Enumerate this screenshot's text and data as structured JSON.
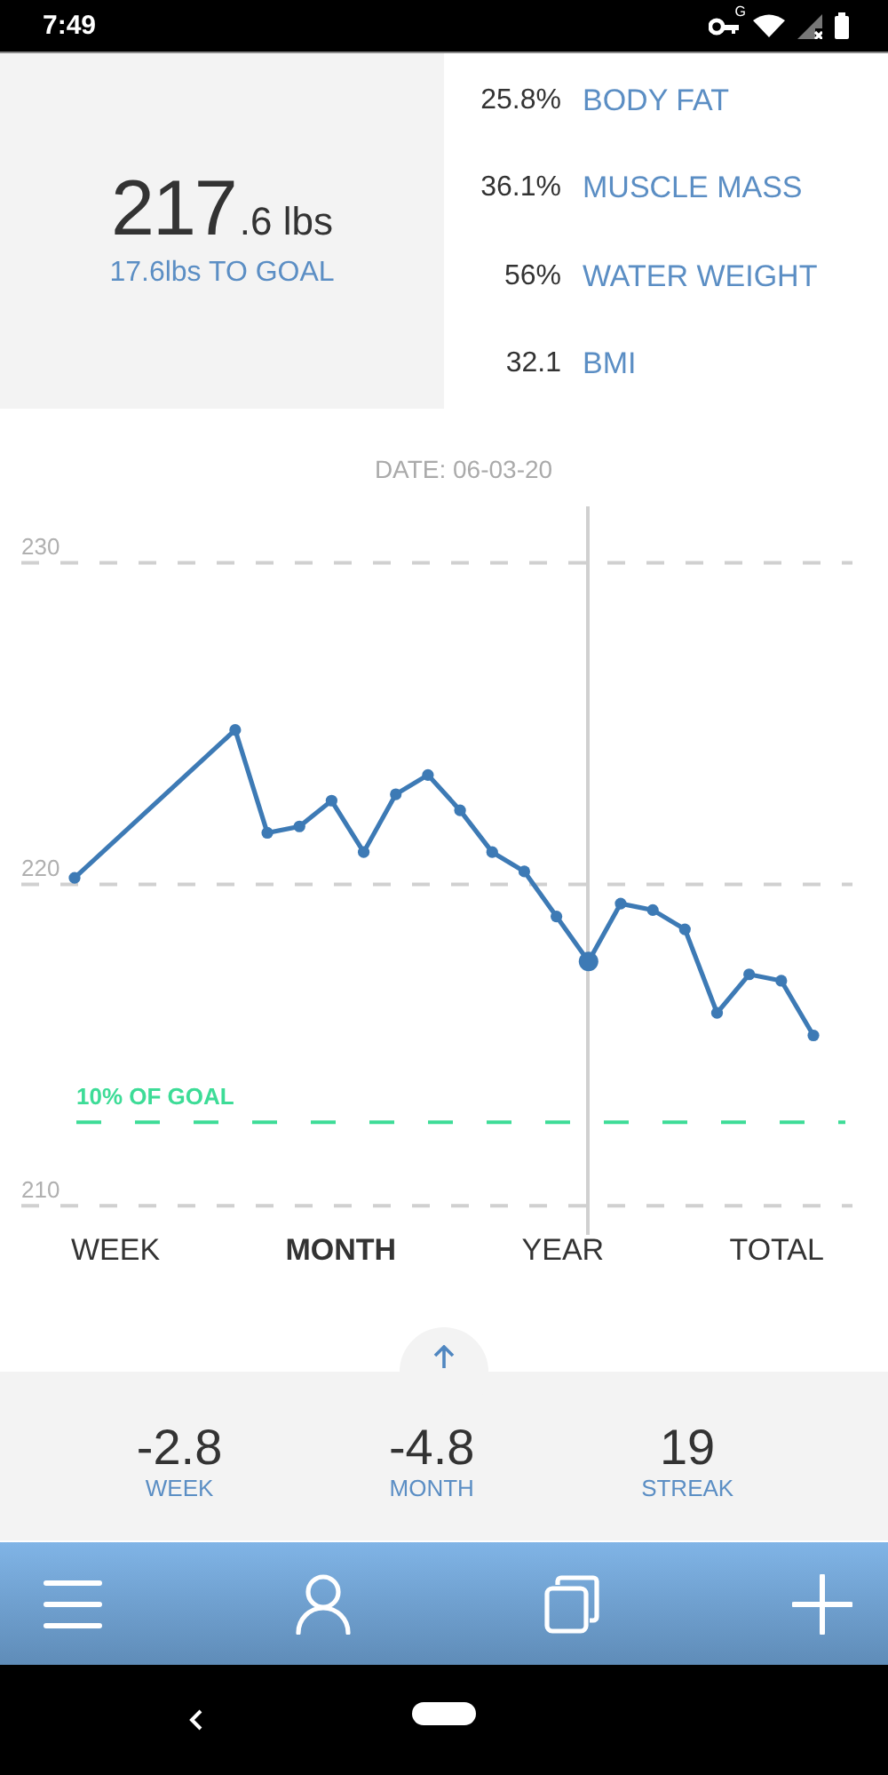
{
  "status_bar": {
    "time": "7:49",
    "key_badge": "G"
  },
  "summary": {
    "weight_whole": "217",
    "weight_fraction": ".6 lbs",
    "to_goal": "17.6lbs TO GOAL"
  },
  "metrics": [
    {
      "value": "25.8%",
      "label": "BODY FAT"
    },
    {
      "value": "36.1%",
      "label": "MUSCLE MASS"
    },
    {
      "value": "56%",
      "label": "WATER WEIGHT"
    },
    {
      "value": "32.1",
      "label": "BMI"
    }
  ],
  "date_label": "DATE:  06-03-20",
  "chart": {
    "chart_data": {
      "type": "line",
      "categories": [
        null,
        null,
        null,
        null,
        null,
        null,
        null,
        null,
        null,
        null,
        null,
        null,
        null,
        null,
        null,
        null,
        null,
        null,
        null,
        null,
        null,
        null,
        null,
        null
      ],
      "ylim": [
        192.3,
        247.5
      ],
      "yticks": [
        210,
        220,
        230
      ],
      "grid": true,
      "series": [
        {
          "color": "#3d7ab5",
          "marker": true,
          "values": [
            220.2,
            null,
            null,
            null,
            null,
            224.8,
            221.6,
            221.8,
            222.6,
            221.0,
            222.8,
            223.4,
            222.3,
            221.0,
            220.4,
            219.0,
            217.6,
            219.4,
            219.2,
            218.6,
            216.0,
            217.2,
            217.0,
            215.3
          ]
        }
      ],
      "ref_lines": [
        {
          "axis": "y",
          "value": 212.6,
          "label": "10% OF GOAL",
          "color": "#3ddc97"
        }
      ]
    }
  },
  "ranges": [
    {
      "label": "WEEK",
      "selected": false
    },
    {
      "label": "MONTH",
      "selected": true
    },
    {
      "label": "YEAR",
      "selected": false
    },
    {
      "label": "TOTAL",
      "selected": false
    }
  ],
  "stats": [
    {
      "value": "-2.8",
      "label": "WEEK"
    },
    {
      "value": "-4.8",
      "label": "MONTH"
    },
    {
      "value": "19",
      "label": "STREAK"
    }
  ],
  "nav": [
    {
      "kind": "menu"
    },
    {
      "kind": "profile"
    },
    {
      "kind": "copies"
    },
    {
      "kind": "add"
    }
  ]
}
